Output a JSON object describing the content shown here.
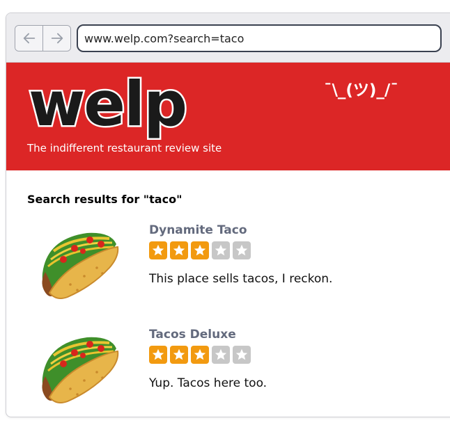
{
  "browser": {
    "address": "www.welp.com?search=taco",
    "back_icon": "arrow-left-icon",
    "forward_icon": "arrow-right-icon"
  },
  "site": {
    "logo_text": "welp",
    "shrug": "¯\\_(ツ)_/¯",
    "tagline": "The indifferent restaurant review site",
    "brand_color": "#dc2626"
  },
  "search": {
    "heading": "Search results for \"taco\""
  },
  "results": [
    {
      "name": "Dynamite Taco",
      "rating": 3,
      "max_rating": 5,
      "description": "This place sells tacos, I reckon.",
      "image": "taco-image"
    },
    {
      "name": "Tacos Deluxe",
      "rating": 3,
      "max_rating": 5,
      "description": "Yup. Tacos here too.",
      "image": "taco-image"
    }
  ],
  "colors": {
    "star_filled": "#f29a10",
    "star_empty": "#c7c7c7",
    "result_name": "#636a7d"
  }
}
